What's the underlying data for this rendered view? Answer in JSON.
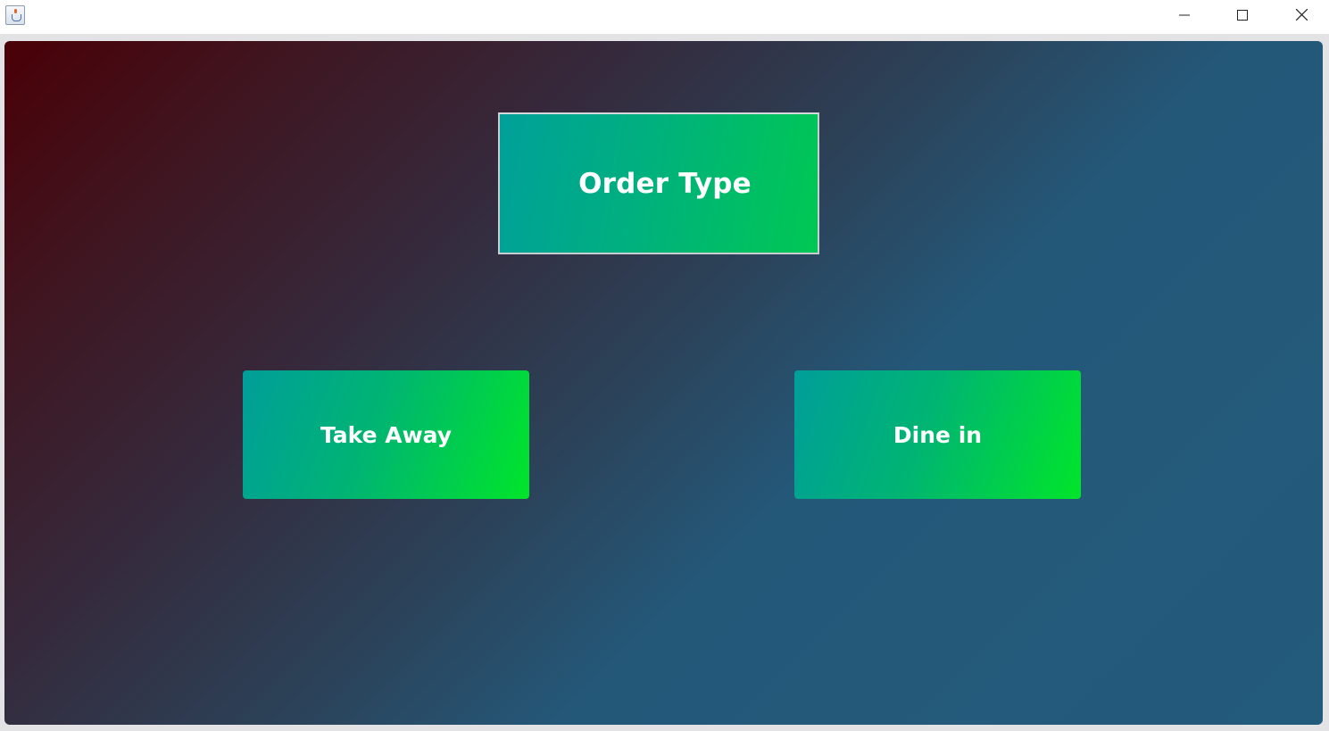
{
  "window": {
    "title": "",
    "app_icon": "java-cup-icon",
    "controls": {
      "minimize_icon": "minimize-icon",
      "maximize_icon": "maximize-icon",
      "close_icon": "close-icon"
    }
  },
  "main": {
    "heading": "Order Type",
    "options": [
      {
        "label": "Take Away"
      },
      {
        "label": "Dine in"
      }
    ]
  },
  "colors": {
    "background_gradient_start": "#4a0006",
    "background_gradient_end": "#235b7c",
    "button_gradient_start": "#009e9a",
    "button_gradient_end": "#00e52a",
    "text": "#ffffff"
  }
}
